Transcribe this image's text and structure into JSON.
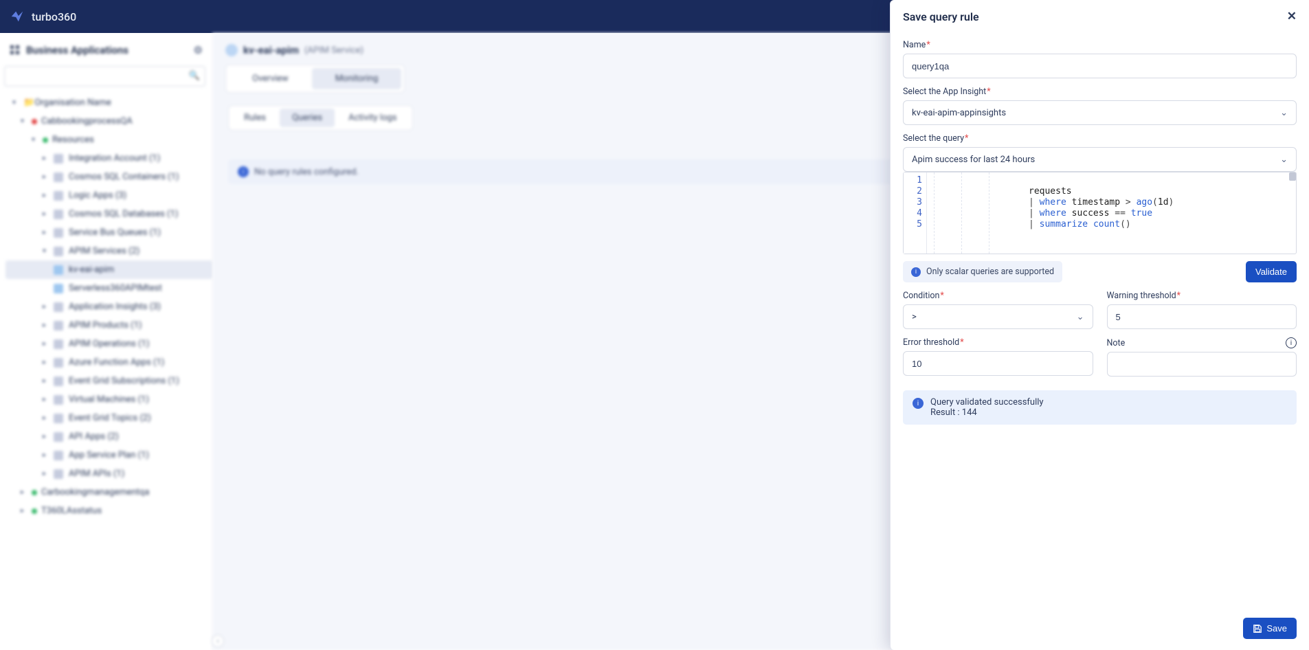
{
  "brand": "turbo360",
  "sidebar_title": "Business Applications",
  "tree": {
    "org": "Organisation Name",
    "env": "CabbookingprocessQA",
    "resources_label": "Resources",
    "items": [
      "Integration Account (1)",
      "Cosmos SQL Containers (1)",
      "Logic Apps (3)",
      "Cosmos SQL Databases (1)",
      "Service Bus Queues (1)"
    ],
    "apim_group": "APIM Services (2)",
    "apim_children": [
      "kv-eai-apim",
      "Serverless360APIMtest"
    ],
    "tail": [
      "Application Insights (3)",
      "APIM Products (1)",
      "APIM Operations (1)",
      "Azure Function Apps (1)",
      "Event Grid Subscriptions (1)",
      "Virtual Machines (1)",
      "Event Grid Topics (2)",
      "API Apps (2)",
      "App Service Plan (1)",
      "APIM APIs (1)"
    ],
    "siblings": [
      "Carbookingmanagementqa",
      "T360LAsstatus"
    ]
  },
  "page": {
    "resource": "kv-eai-apim",
    "resource_type": "(APIM Service)",
    "tabs_primary": [
      "Overview",
      "Monitoring"
    ],
    "tabs_secondary": [
      "Rules",
      "Queries",
      "Activity logs"
    ],
    "no_rules": "No query rules configured."
  },
  "panel": {
    "title": "Save query rule",
    "name_label": "Name",
    "name_value": "query1qa",
    "appinsight_label": "Select the App Insight",
    "appinsight_value": "kv-eai-apim-appinsights",
    "query_label": "Select the query",
    "query_value": "Apim success for last 24 hours",
    "scalar_note": "Only scalar queries are supported",
    "validate_label": "Validate",
    "condition_label": "Condition",
    "condition_value": ">",
    "warn_label": "Warning threshold",
    "warn_value": "5",
    "err_label": "Error threshold",
    "err_value": "10",
    "note_label": "Note",
    "validated_msg": "Query validated successfully",
    "validated_result": "Result : 144",
    "save_label": "Save",
    "code": {
      "l1": "requests",
      "l2_kw": "where",
      "l2_id": "timestamp",
      "l2_op": ">",
      "l2_fn": "ago",
      "l2_arg": "1d",
      "l3_kw": "where",
      "l3_id": "success",
      "l3_op": "==",
      "l3_val": "true",
      "l4_kw": "summarize",
      "l4_fn": "count"
    }
  }
}
